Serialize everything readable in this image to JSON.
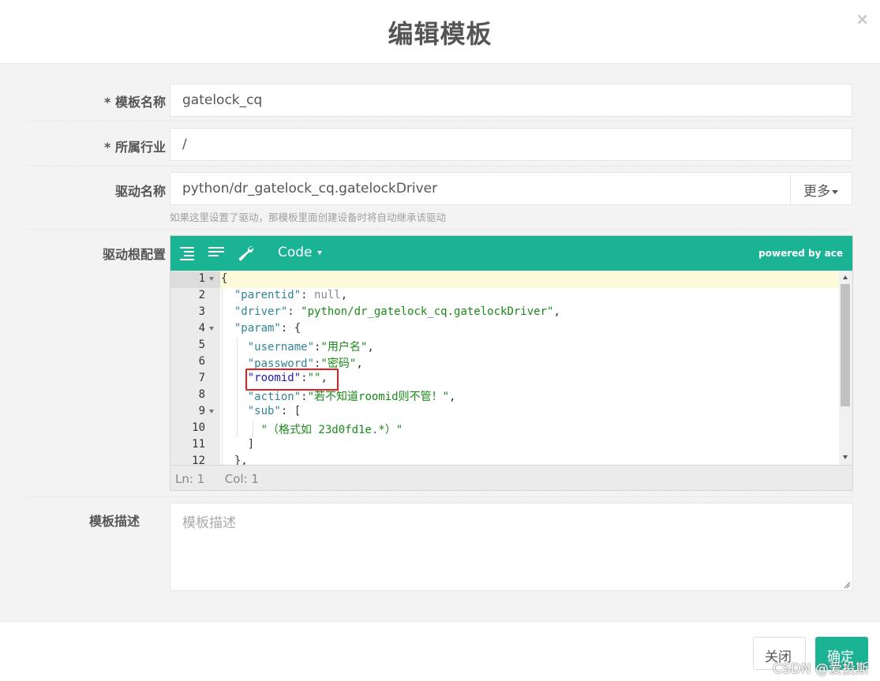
{
  "modal": {
    "title": "编辑模板",
    "close_glyph": "×"
  },
  "form": {
    "template_name": {
      "label": "* 模板名称",
      "value": "gatelock_cq"
    },
    "industry": {
      "label": "* 所属行业",
      "value": "/"
    },
    "driver_name": {
      "label": "驱动名称",
      "value": "python/dr_gatelock_cq.gatelockDriver",
      "more_label": "更多",
      "help": "如果这里设置了驱动，那模板里面创建设备时将自动继承该驱动"
    },
    "driver_config": {
      "label": "驱动根配置"
    },
    "description": {
      "label": "模板描述",
      "placeholder": "模板描述"
    }
  },
  "editor": {
    "mode_label": "Code",
    "powered_by": "powered by ace",
    "status": {
      "ln": "Ln: 1",
      "col": "Col: 1"
    },
    "line_numbers": [
      "1",
      "2",
      "3",
      "4",
      "5",
      "6",
      "7",
      "8",
      "9",
      "10",
      "11",
      "12"
    ],
    "code": {
      "l1": "{",
      "l2_key": "\"parentid\"",
      "l2_rest": ": ",
      "l2_val": "null",
      "l2_end": ",",
      "l3_key": "\"driver\"",
      "l3_rest": ": ",
      "l3_val": "\"python/dr_gatelock_cq.gatelockDriver\"",
      "l3_end": ",",
      "l4_key": "\"param\"",
      "l4_rest": ": {",
      "l5_key": "\"username\"",
      "l5_rest": ":",
      "l5_val": "\"用户名\"",
      "l5_end": ",",
      "l6_key": "\"password\"",
      "l6_rest": ":",
      "l6_val": "\"密码\"",
      "l6_end": ",",
      "l7_key": "\"roomid\"",
      "l7_rest": ":",
      "l7_val": "\"\"",
      "l7_end": ",",
      "l8_key": "\"action\"",
      "l8_rest": ":",
      "l8_val": "\"若不知道roomid则不管！\"",
      "l8_end": ",",
      "l9_key": "\"sub\"",
      "l9_rest": ": [",
      "l10_val": "\"（格式如 23d0fd1e.*）\"",
      "l11": "]",
      "l12": "},"
    }
  },
  "footer": {
    "close_label": "关闭",
    "ok_label": "确定"
  },
  "watermark": "CSDN @爱投斯",
  "colors": {
    "accent": "#1ab394",
    "highlight_box": "#e02020"
  }
}
